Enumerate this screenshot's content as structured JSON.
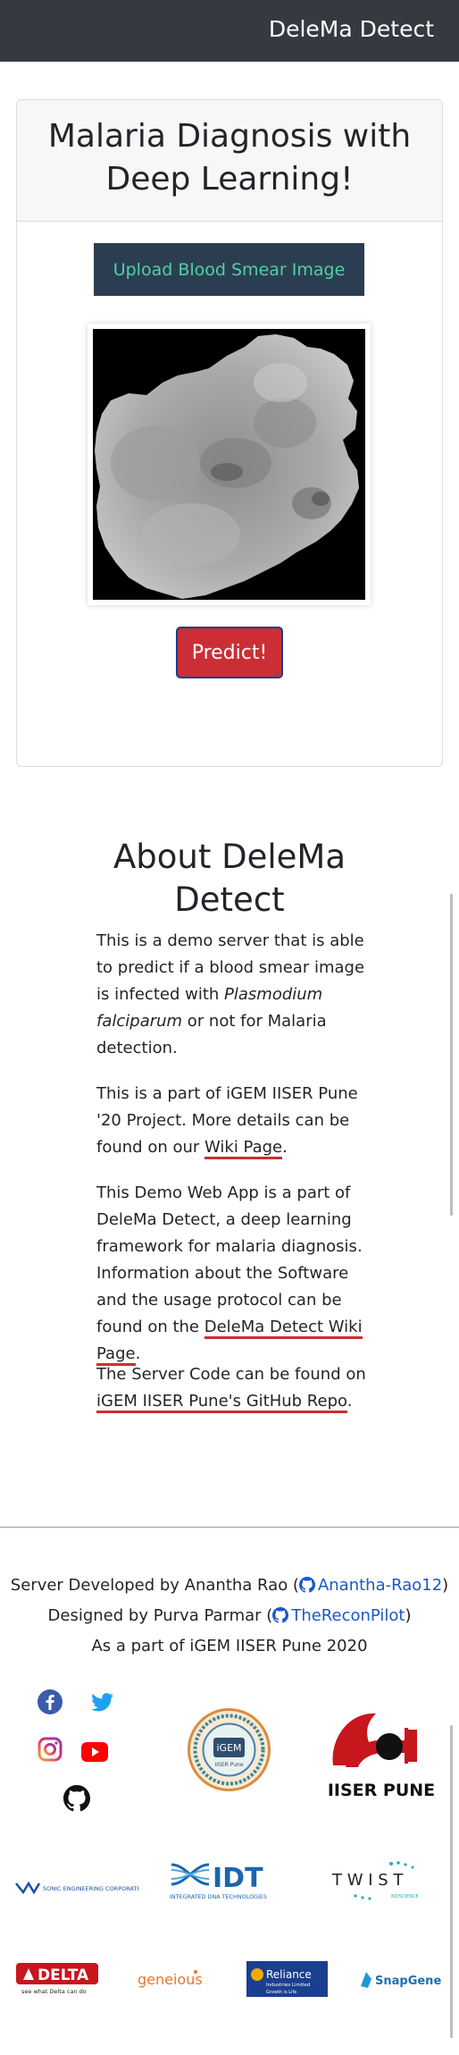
{
  "navbar": {
    "brand": "DeleMa Detect"
  },
  "card": {
    "title": "Malaria Diagnosis with Deep Learning!",
    "upload_label": "Upload Blood Smear Image",
    "predict_label": "Predict!"
  },
  "about": {
    "title": "About DeleMa Detect",
    "p1_before": "This is a demo server that is able to predict if a blood smear image is infected with ",
    "p1_em": "Plasmodium falciparum",
    "p1_after": " or not for Malaria detection.",
    "p2_before": "This is a part of iGEM IISER Pune '20 Project. More details can be found on our ",
    "p2_link": "Wiki Page",
    "p2_after": ".",
    "p3_before": "This Demo Web App is a part of DeleMa Detect, a deep learning framework for malaria diagnosis. Information about the Software and the usage protocol can be found on the ",
    "p3_link": "DeleMa Detect Wiki Page",
    "p3_after": ".",
    "p4_before": "The Server Code can be found on ",
    "p4_link": "iGEM IISER Pune's GitHub Repo",
    "p4_after": "."
  },
  "footer": {
    "line1_before": "Server Developed by Anantha Rao (",
    "line1_link": "Anantha-Rao12",
    "line1_after": ")",
    "line2_before": "Designed by Purva Parmar (",
    "line2_link": "TheReconPilot",
    "line2_after": ")",
    "line3": "As a part of iGEM IISER Pune 2020"
  },
  "logos": {
    "igem_text": "iGEM",
    "igem_sub": "IISER Pune",
    "iiser": "IISER PUNE",
    "sonic": "SONIC ENGINEERING CORPORATION",
    "idt": "IDT",
    "idt_sub": "INTEGRATED DNA TECHNOLOGIES",
    "twist": "T W I S T",
    "twist_sub": "BIOSCIENCE",
    "delta": "DELTA",
    "delta_sub": "see what Delta can do",
    "geneious": "geneious",
    "reliance": "Reliance",
    "reliance_sub": "Industries Limited",
    "reliance_sub2": "Growth is Life",
    "snapgene": "SnapGene"
  },
  "icons": [
    "facebook-icon",
    "twitter-icon",
    "instagram-icon",
    "youtube-icon",
    "github-icon"
  ],
  "colors": {
    "navbar": "#343a40",
    "upload_bg": "#2b3e51",
    "upload_text": "#4fd1a5",
    "predict_bg": "#cc2e35",
    "link": "#1a58c9",
    "underline": "#cc2e35"
  }
}
